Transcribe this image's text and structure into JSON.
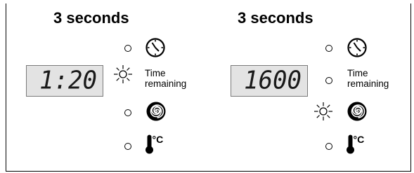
{
  "panels": [
    {
      "heading": "3 seconds",
      "display_value": "1:20",
      "time_label_line1": "Time",
      "time_label_line2": "remaining",
      "lit_indicator": "time-remaining"
    },
    {
      "heading": "3 seconds",
      "display_value": "1600",
      "time_label_line1": "Time",
      "time_label_line2": "remaining",
      "lit_indicator": "spiral"
    }
  ],
  "icons": {
    "clock": "clock-icon",
    "spiral": "spiral-icon",
    "thermometer": "thermometer-celsius-icon",
    "indicator_lit": "sun-icon",
    "indicator_off": "circle-indicator"
  },
  "thermo_unit": "°C"
}
